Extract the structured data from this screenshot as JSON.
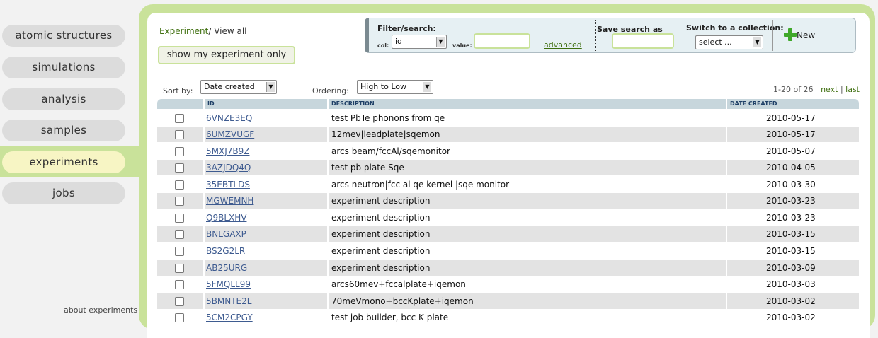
{
  "sidebar": {
    "items": [
      {
        "label": "atomic structures"
      },
      {
        "label": "simulations"
      },
      {
        "label": "analysis"
      },
      {
        "label": "samples"
      },
      {
        "label": "experiments",
        "active": true
      },
      {
        "label": "jobs"
      }
    ],
    "about_label": "about experiments"
  },
  "breadcrumb": {
    "link": "Experiment",
    "separator": "/",
    "current": " View all"
  },
  "mine_button": "show my experiment only",
  "filter": {
    "title": "Filter/search:",
    "col_label": "col:",
    "col_value": "id",
    "value_label": "value:",
    "advanced_label": "advanced",
    "save_label": "Save search as",
    "collection_label": "Switch to a collection:",
    "collection_value": "select ...",
    "new_label": "New"
  },
  "sort": {
    "label": "Sort by:",
    "value": "Date created",
    "ordering_label": "Ordering:",
    "ordering_value": "High to Low"
  },
  "pager": {
    "range": "1-20 of 26",
    "next": "next",
    "sep": "|",
    "last": "last"
  },
  "table": {
    "columns": [
      "ID",
      "DESCRIPTION",
      "DATE CREATED"
    ],
    "rows": [
      {
        "id": "6VNZE3EQ",
        "description": "test PbTe phonons from qe",
        "date": "2010-05-17"
      },
      {
        "id": "6UMZVUGF",
        "description": "12mev|leadplate|sqemon",
        "date": "2010-05-17"
      },
      {
        "id": "5MXJ7B9Z",
        "description": "arcs beam/fccAl/sqemonitor",
        "date": "2010-05-07"
      },
      {
        "id": "3AZJDQ4Q",
        "description": "test pb plate Sqe",
        "date": "2010-04-05"
      },
      {
        "id": "35EBTLDS",
        "description": "arcs neutron|fcc al qe kernel |sqe monitor",
        "date": "2010-03-30"
      },
      {
        "id": "MGWEMNH",
        "description": "experiment description",
        "date": "2010-03-23"
      },
      {
        "id": "Q9BLXHV",
        "description": "experiment description",
        "date": "2010-03-23"
      },
      {
        "id": "BNLGAXP",
        "description": "experiment description",
        "date": "2010-03-15"
      },
      {
        "id": "BS2G2LR",
        "description": "experiment description",
        "date": "2010-03-15"
      },
      {
        "id": "AB25URG",
        "description": "experiment description",
        "date": "2010-03-09"
      },
      {
        "id": "5FMQLL99",
        "description": "arcs60mev+fccalplate+iqemon",
        "date": "2010-03-03"
      },
      {
        "id": "5BMNTE2L",
        "description": "70meVmono+bccKplate+iqemon",
        "date": "2010-03-02"
      },
      {
        "id": "5CM2CPGY",
        "description": "test job builder, bcc K plate",
        "date": "2010-03-02"
      }
    ]
  },
  "colors": {
    "accent": "#c9e29a",
    "link": "#3e5b90",
    "header": "#c7d6dc"
  }
}
